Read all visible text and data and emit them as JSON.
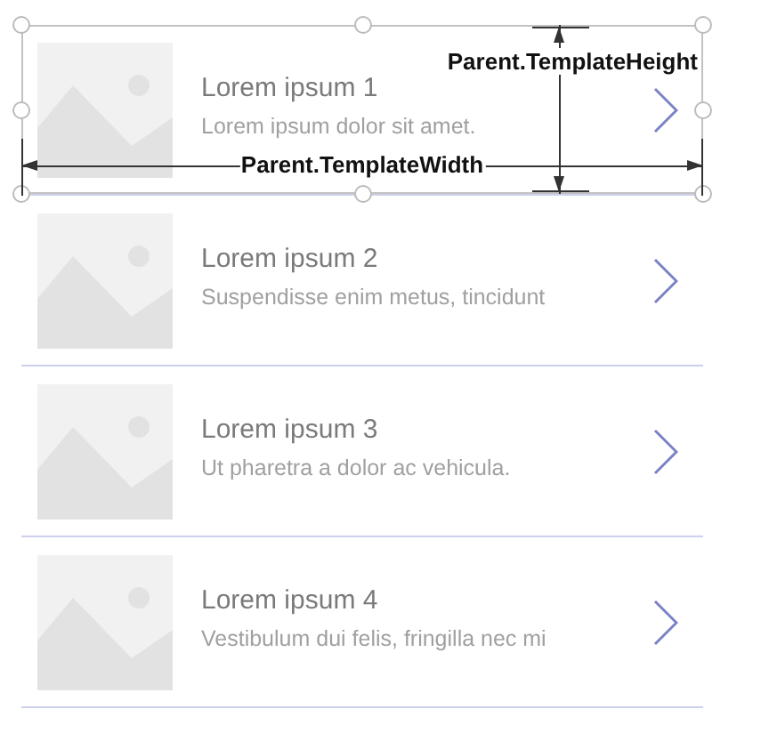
{
  "gallery": {
    "items": [
      {
        "title": "Lorem ipsum 1",
        "subtitle": "Lorem ipsum dolor sit amet.",
        "selected": true
      },
      {
        "title": "Lorem ipsum 2",
        "subtitle": "Suspendisse enim metus, tincidunt",
        "selected": false
      },
      {
        "title": "Lorem ipsum 3",
        "subtitle": "Ut pharetra a dolor ac vehicula.",
        "selected": false
      },
      {
        "title": "Lorem ipsum 4",
        "subtitle": "Vestibulum dui felis, fringilla nec mi",
        "selected": false
      }
    ]
  },
  "annotations": {
    "height_label": "Parent.TemplateHeight",
    "width_label": "Parent.TemplateWidth"
  }
}
